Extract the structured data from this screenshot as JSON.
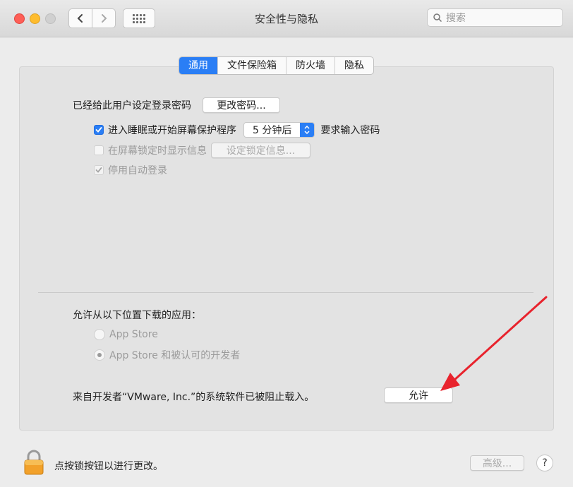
{
  "window": {
    "title": "安全性与隐私",
    "search_placeholder": "搜索"
  },
  "tabs": [
    {
      "label": "通用",
      "active": true
    },
    {
      "label": "文件保险箱",
      "active": false
    },
    {
      "label": "防火墙",
      "active": false
    },
    {
      "label": "隐私",
      "active": false
    }
  ],
  "general": {
    "password_label": "已经给此用户设定登录密码",
    "change_password_button": "更改密码...",
    "require_password": {
      "checked": true,
      "label": "进入睡眠或开始屏幕保护程序",
      "delay_value": "5 分钟后",
      "suffix": "要求输入密码"
    },
    "show_message": {
      "checked": false,
      "label": "在屏幕锁定时显示信息",
      "button": "设定锁定信息..."
    },
    "disable_autologin": {
      "checked": true,
      "label": "停用自动登录"
    }
  },
  "downloads": {
    "heading": "允许从以下位置下载的应用：",
    "options": [
      {
        "label": "App Store",
        "selected": false
      },
      {
        "label": "App Store 和被认可的开发者",
        "selected": true
      }
    ],
    "blocked_message": "来自开发者“VMware, Inc.”的系统软件已被阻止载入。",
    "allow_button": "允许"
  },
  "footer": {
    "lock_text": "点按锁按钮以进行更改。",
    "advanced_button": "高级...",
    "help_label": "?"
  },
  "colors": {
    "accent": "#2a7ef5",
    "annotation_arrow": "#e8232d"
  }
}
